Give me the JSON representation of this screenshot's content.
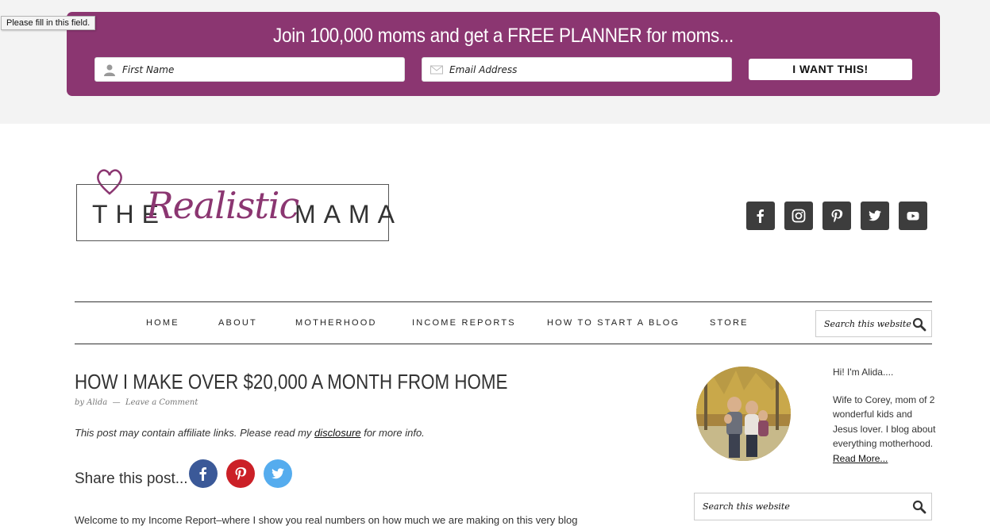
{
  "tooltip": "Please fill in this field.",
  "optin": {
    "title": "Join 100,000 moms and get a FREE PLANNER for moms...",
    "first_name_placeholder": "First Name",
    "email_placeholder": "Email Address",
    "button": "I WANT THIS!"
  },
  "logo": {
    "the": "THE",
    "realistic": "Realistic",
    "mama": "MAMA"
  },
  "social": [
    "facebook-icon",
    "instagram-icon",
    "pinterest-icon",
    "twitter-icon",
    "youtube-icon"
  ],
  "nav": {
    "items": [
      "HOME",
      "ABOUT",
      "MOTHERHOOD",
      "INCOME REPORTS",
      "HOW TO START A BLOG",
      "STORE"
    ],
    "search_placeholder": "Search this website"
  },
  "post": {
    "title": "HOW I MAKE OVER $20,000 A MONTH FROM HOME",
    "by": "by",
    "author": "Alida",
    "sep": "—",
    "comment": "Leave a Comment",
    "affiliate_pre": "This post may contain affiliate links. Please read my",
    "affiliate_link": "disclosure",
    "affiliate_post": "for more info.",
    "share_label": "Share this post...",
    "intro": "Welcome to my Income Report–where I show you real numbers on how much we are making on this very blog"
  },
  "sidebar": {
    "greeting": "Hi! I'm Alida....",
    "bio": "Wife to Corey, mom of 2 wonderful kids and Jesus lover. I blog about everything motherhood.",
    "read_more": "Read More...",
    "search_placeholder": "Search this website"
  },
  "colors": {
    "brand": "#8b3671",
    "facebook": "#3b5998",
    "pinterest": "#cb2027",
    "twitter": "#55acee"
  }
}
